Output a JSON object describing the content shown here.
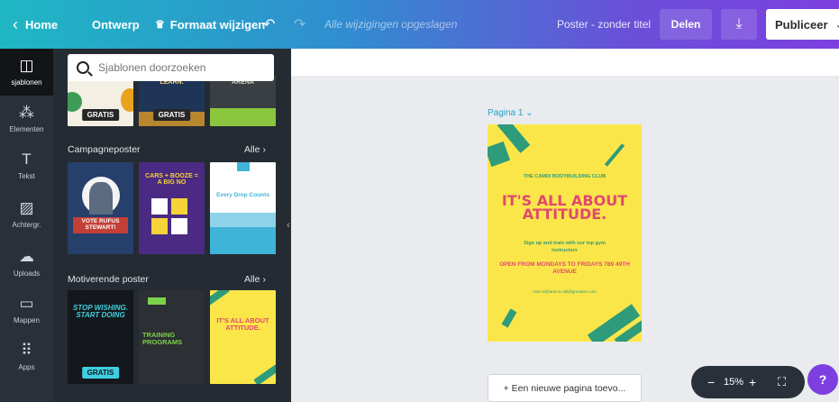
{
  "topbar": {
    "home": "Home",
    "ontwerp": "Ontwerp",
    "resize": "Formaat wijzigen",
    "saved_status": "Alle wijzigingen opgeslagen",
    "poster_title": "Poster - zonder titel",
    "share": "Delen",
    "publish": "Publiceer"
  },
  "sidebar": {
    "items": [
      {
        "label": "sjablonen",
        "icon": "templates-icon",
        "glyph": "◫"
      },
      {
        "label": "Elementen",
        "icon": "elements-icon",
        "glyph": "⁂"
      },
      {
        "label": "Tekst",
        "icon": "text-icon",
        "glyph": "T"
      },
      {
        "label": "Achtergr.",
        "icon": "background-icon",
        "glyph": "▨"
      },
      {
        "label": "Uploads",
        "icon": "upload-icon",
        "glyph": "☁"
      },
      {
        "label": "Mappen",
        "icon": "folder-icon",
        "glyph": "▭"
      },
      {
        "label": "Apps",
        "icon": "apps-icon",
        "glyph": "⠿"
      }
    ]
  },
  "panel": {
    "search_placeholder": "Sjablonen doorzoeken",
    "sections": [
      {
        "title": "Campagneposter",
        "all": "Alle"
      },
      {
        "title": "Motiverende poster",
        "all": "Alle"
      }
    ],
    "gratis": "GRATIS",
    "top_row": {
      "a": "LEARN.",
      "b": "ARENA"
    },
    "campaign": {
      "a_title": "VOTE RUFUS STEWART!",
      "b_title": "CARS + BOOZE = A BIG NO",
      "c_title": "Every Drop Counts"
    },
    "motivation": {
      "a_title": "STOP WISHING. START DOING",
      "b_title": "TRAINING PROGRAMS",
      "c_title": "IT'S ALL ABOUT ATTITUDE."
    }
  },
  "canvas": {
    "page_label": "Pagina 1",
    "add_page": "+ Een nieuwe pagina toevo...",
    "zoom": "15%",
    "help": "?"
  },
  "poster": {
    "club": "THE CAMDI BODYBUILDING CLUB",
    "headline": "IT'S ALL ABOUT ATTITUDE.",
    "sub": "Sign up and train with our top gym instructors",
    "hours": "OPEN FROM MONDAYS TO FRIDAYS 789 49TH AVENUE",
    "mail": "visit us@and.or.call@greatsite.com"
  },
  "colors": {
    "poster_bg": "#fbe64a",
    "poster_accent": "#e0496f",
    "poster_green": "#2e9b7a",
    "brand_purple": "#7d3fe0",
    "brand_teal": "#1fb7c4"
  }
}
